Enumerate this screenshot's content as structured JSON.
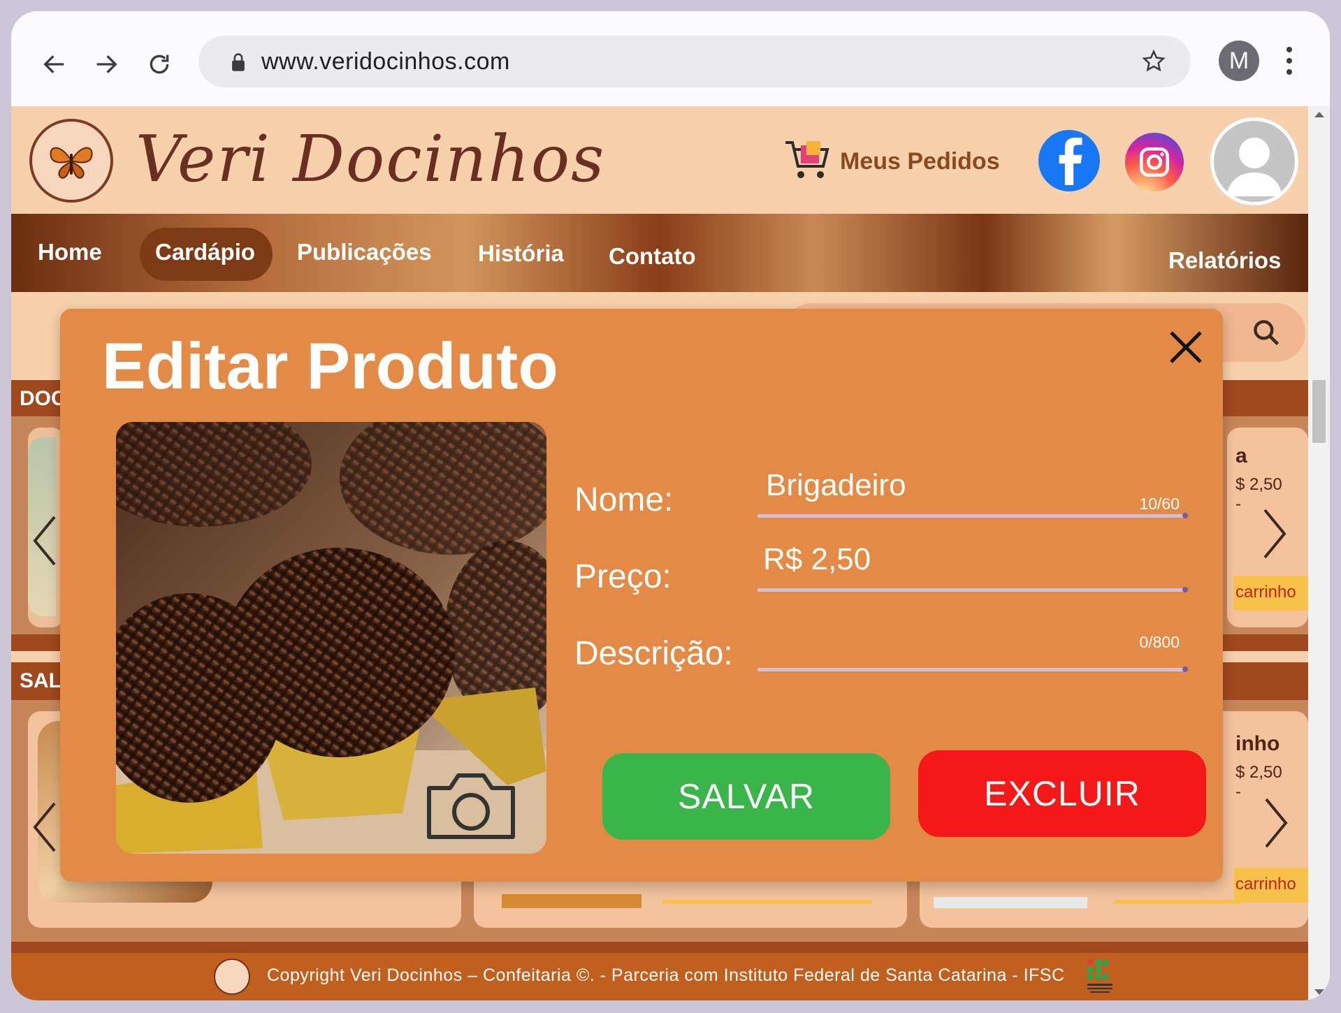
{
  "browser": {
    "url": "www.veridocinhos.com",
    "profile_initial": "M"
  },
  "header": {
    "brand": "Veri Docinhos",
    "orders_label": "Meus Pedidos"
  },
  "nav": {
    "items": [
      "Home",
      "Cardápio",
      "Publicações",
      "História",
      "Contato"
    ],
    "active": "Cardápio",
    "reports_label": "Relatórios"
  },
  "sections": {
    "doces_label": "DOC",
    "salgados_label": "SAL"
  },
  "side_cards": [
    {
      "title": "a",
      "price": "$ 2,50",
      "extra": "-",
      "cart_label": "carrinho"
    },
    {
      "title": "inho",
      "price": "$ 2,50",
      "extra": "-",
      "cart_label": "carrinho"
    }
  ],
  "modal": {
    "title": "Editar Produto",
    "fields": {
      "name_label": "Nome:",
      "name_value": "Brigadeiro",
      "name_counter": "10/60",
      "price_label": "Preço:",
      "price_value": "R$ 2,50",
      "description_label": "Descrição:",
      "description_value": "",
      "description_counter": "0/800"
    },
    "save_label": "SALVAR",
    "delete_label": "EXCLUIR"
  },
  "footer": {
    "text": "Copyright Veri Docinhos – Confeitaria ©. - Parceria com Instituto Federal de Santa Catarina - IFSC"
  },
  "colors": {
    "modal_bg": "#e38b46",
    "save": "#39b54a",
    "delete": "#f41818",
    "page_bg": "#f7d0ac",
    "footer_bg": "#c05f1e"
  },
  "icons": [
    "back-arrow-icon",
    "forward-arrow-icon",
    "reload-icon",
    "lock-icon",
    "star-icon",
    "kebab-menu-icon",
    "cart-icon",
    "facebook-icon",
    "instagram-icon",
    "user-avatar-icon",
    "search-icon",
    "close-icon",
    "camera-icon",
    "chevron-right-icon",
    "chevron-left-icon"
  ]
}
